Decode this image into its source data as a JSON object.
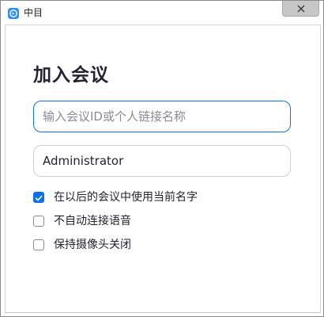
{
  "window": {
    "title": "中目"
  },
  "dialog": {
    "heading": "加入会议",
    "meeting_id_input": {
      "value": "",
      "placeholder": "输入会议ID或个人链接名称"
    },
    "name_input": {
      "value": "Administrator",
      "placeholder": ""
    },
    "options": [
      {
        "label": "在以后的会议中使用当前名字",
        "checked": true
      },
      {
        "label": "不自动连接语音",
        "checked": false
      },
      {
        "label": "保持摄像头关闭",
        "checked": false
      }
    ]
  },
  "colors": {
    "accent": "#0e71eb",
    "text": "#232333",
    "close_button_bg": "#c7c7c7"
  },
  "icons": {
    "app": "app-logo-icon",
    "close": "close-icon",
    "check": "checkmark-icon"
  }
}
